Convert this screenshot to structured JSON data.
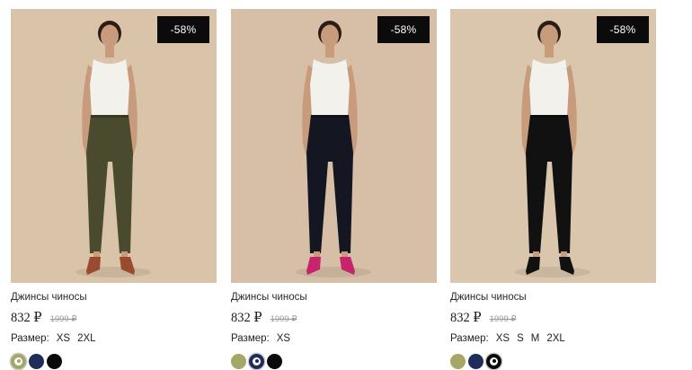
{
  "products": [
    {
      "discount_badge": "-58%",
      "title": "Джинсы чиносы",
      "price": "832 ₽",
      "old_price": "1999 ₽",
      "size_label": "Размер:",
      "sizes": [
        "XS",
        "2XL"
      ],
      "colors": [
        "#a4a765",
        "#1f2d5a",
        "#0a0a0a"
      ],
      "selected_color": 0,
      "pants_color": "#4a4b2e",
      "shoe_color": "#9a4a2e",
      "bg_color": "#d9c4a9"
    },
    {
      "discount_badge": "-58%",
      "title": "Джинсы чиносы",
      "price": "832 ₽",
      "old_price": "1999 ₽",
      "size_label": "Размер:",
      "sizes": [
        "XS"
      ],
      "colors": [
        "#a4a765",
        "#1f2d5a",
        "#0a0a0a"
      ],
      "selected_color": 1,
      "pants_color": "#141722",
      "shoe_color": "#c8246b",
      "bg_color": "#d6bfa6"
    },
    {
      "discount_badge": "-58%",
      "title": "Джинсы чиносы",
      "price": "832 ₽",
      "old_price": "1999 ₽",
      "size_label": "Размер:",
      "sizes": [
        "XS",
        "S",
        "M",
        "2XL"
      ],
      "colors": [
        "#a4a765",
        "#1f2d5a",
        "#0a0a0a"
      ],
      "selected_color": 2,
      "pants_color": "#111111",
      "shoe_color": "#111111",
      "bg_color": "#dac6ac"
    }
  ]
}
